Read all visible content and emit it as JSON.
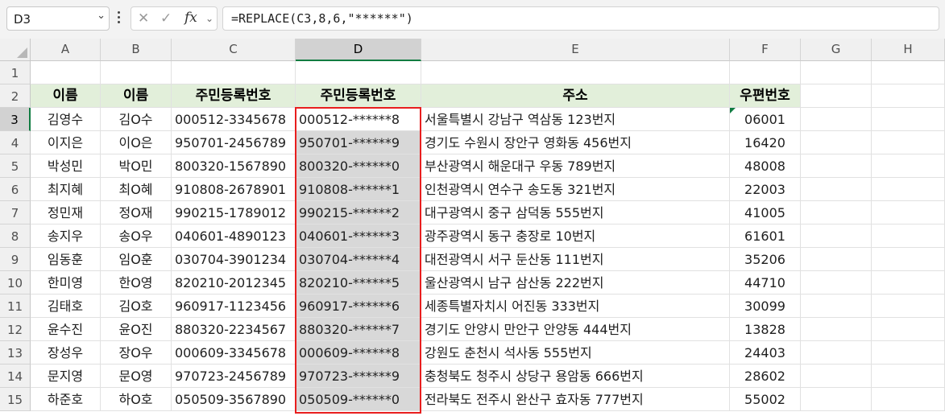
{
  "name_box": {
    "value": "D3"
  },
  "formula_bar": {
    "cancel": "✕",
    "enter": "✓",
    "fx": "fx",
    "formula": "=REPLACE(C3,8,6,\"******\")"
  },
  "columns": [
    "A",
    "B",
    "C",
    "D",
    "E",
    "F",
    "G",
    "H"
  ],
  "rows": [
    "1",
    "2",
    "3",
    "4",
    "5",
    "6",
    "7",
    "8",
    "9",
    "10",
    "11",
    "12",
    "13",
    "14",
    "15"
  ],
  "headers": {
    "a": "이름",
    "b": "이름",
    "c": "주민등록번호",
    "d": "주민등록번호",
    "e": "주소",
    "f": "우편번호"
  },
  "data": [
    {
      "a": "김영수",
      "b": "김O수",
      "c": "000512-3345678",
      "d": "000512-******8",
      "e": "서울특별시 강남구 역삼동 123번지",
      "f": "06001"
    },
    {
      "a": "이지은",
      "b": "이O은",
      "c": "950701-2456789",
      "d": "950701-******9",
      "e": "경기도 수원시 장안구 영화동 456번지",
      "f": "16420"
    },
    {
      "a": "박성민",
      "b": "박O민",
      "c": "800320-1567890",
      "d": "800320-******0",
      "e": "부산광역시 해운대구 우동 789번지",
      "f": "48008"
    },
    {
      "a": "최지혜",
      "b": "최O혜",
      "c": "910808-2678901",
      "d": "910808-******1",
      "e": "인천광역시 연수구 송도동 321번지",
      "f": "22003"
    },
    {
      "a": "정민재",
      "b": "정O재",
      "c": "990215-1789012",
      "d": "990215-******2",
      "e": "대구광역시 중구 삼덕동 555번지",
      "f": "41005"
    },
    {
      "a": "송지우",
      "b": "송O우",
      "c": "040601-4890123",
      "d": "040601-******3",
      "e": "광주광역시 동구 충장로 10번지",
      "f": "61601"
    },
    {
      "a": "임동훈",
      "b": "임O훈",
      "c": "030704-3901234",
      "d": "030704-******4",
      "e": "대전광역시 서구 둔산동 111번지",
      "f": "35206"
    },
    {
      "a": "한미영",
      "b": "한O영",
      "c": "820210-2012345",
      "d": "820210-******5",
      "e": "울산광역시 남구 삼산동 222번지",
      "f": "44710"
    },
    {
      "a": "김태호",
      "b": "김O호",
      "c": "960917-1123456",
      "d": "960917-******6",
      "e": "세종특별자치시 어진동 333번지",
      "f": "30099"
    },
    {
      "a": "윤수진",
      "b": "윤O진",
      "c": "880320-2234567",
      "d": "880320-******7",
      "e": "경기도 안양시 만안구 안양동 444번지",
      "f": "13828"
    },
    {
      "a": "장성우",
      "b": "장O우",
      "c": "000609-3345678",
      "d": "000609-******8",
      "e": "강원도 춘천시 석사동 555번지",
      "f": "24403"
    },
    {
      "a": "문지영",
      "b": "문O영",
      "c": "970723-2456789",
      "d": "970723-******9",
      "e": "충청북도 청주시 상당구 용암동 666번지",
      "f": "28602"
    },
    {
      "a": "하준호",
      "b": "하O호",
      "c": "050509-3567890",
      "d": "050509-******0",
      "e": "전라북도 전주시 완산구 효자동 777번지",
      "f": "55002"
    }
  ],
  "colors": {
    "header_fill": "#e2efda",
    "selection_outline": "#e81e1e",
    "range_fill": "#d8d8d8",
    "accent": "#107c41"
  }
}
